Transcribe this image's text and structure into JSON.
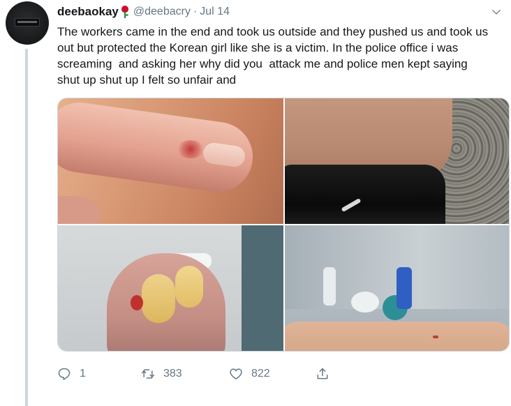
{
  "tweet": {
    "display_name": "deebaokay",
    "name_emoji": "rose-icon",
    "handle": "@deebacry",
    "separator": "·",
    "date": "Jul 14",
    "text": "The workers came in the end and took us outside and they pushed us and took us out but protected the Korean girl like she is a victim. In the police office i was screaming  and asking her why did you  attack me and police men kept saying shut up shut up I felt so unfair and",
    "media": [
      {
        "name": "photo-injured-finger"
      },
      {
        "name": "photo-leg-scratch"
      },
      {
        "name": "photo-damaged-nails"
      },
      {
        "name": "photo-arm-scratch"
      }
    ],
    "actions": {
      "reply": {
        "icon": "reply-icon",
        "count": "1"
      },
      "retweet": {
        "icon": "retweet-icon",
        "count": "383"
      },
      "like": {
        "icon": "heart-icon",
        "count": "822"
      },
      "share": {
        "icon": "share-icon",
        "count": ""
      }
    }
  },
  "colors": {
    "text_primary": "#14171a",
    "text_secondary": "#657786",
    "thread_line": "#ccd6dd"
  }
}
